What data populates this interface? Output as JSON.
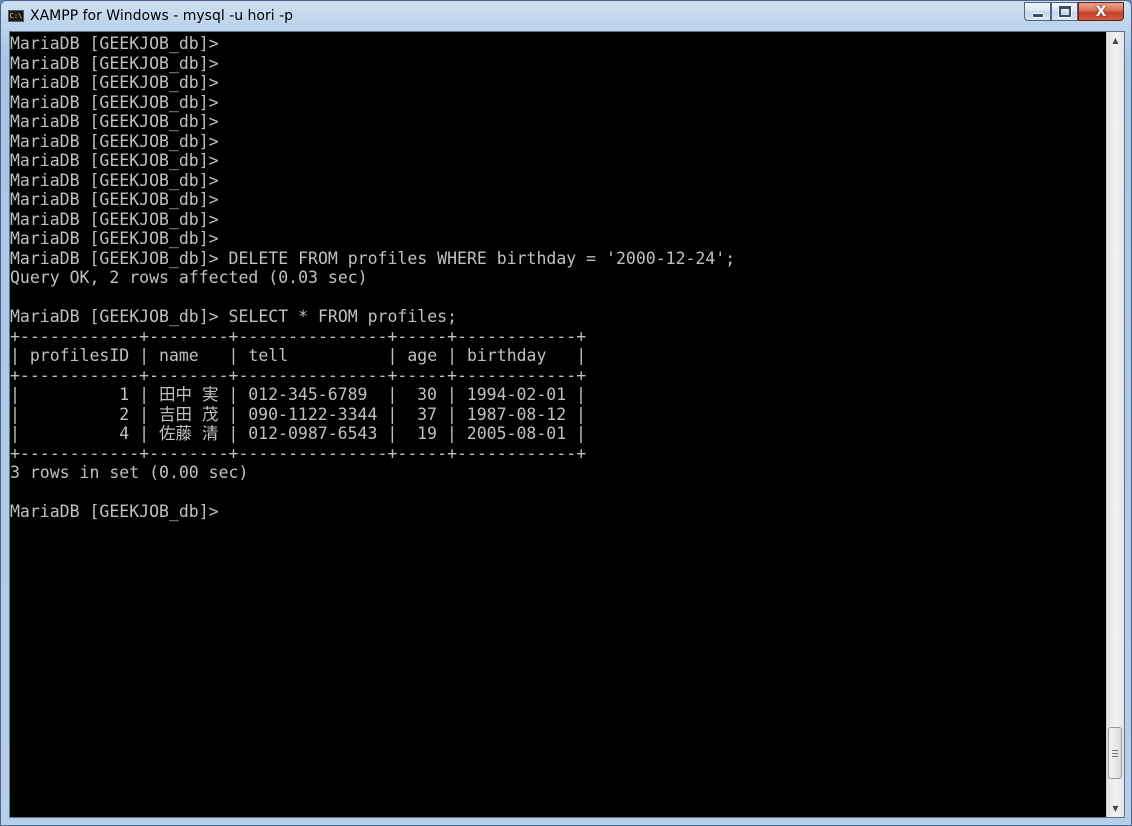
{
  "window": {
    "title": "XAMPP for Windows - mysql  -u hori -p",
    "icon": "console-icon",
    "icon_text": "C:\\",
    "buttons": {
      "minimize": "minimize-icon",
      "maximize": "maximize-icon",
      "close": "close-icon",
      "close_glyph": "X"
    }
  },
  "terminal": {
    "lines": [
      "MariaDB [GEEKJOB_db]>",
      "MariaDB [GEEKJOB_db]>",
      "MariaDB [GEEKJOB_db]>",
      "MariaDB [GEEKJOB_db]>",
      "MariaDB [GEEKJOB_db]>",
      "MariaDB [GEEKJOB_db]>",
      "MariaDB [GEEKJOB_db]>",
      "MariaDB [GEEKJOB_db]>",
      "MariaDB [GEEKJOB_db]>",
      "MariaDB [GEEKJOB_db]>",
      "MariaDB [GEEKJOB_db]>",
      "MariaDB [GEEKJOB_db]> DELETE FROM profiles WHERE birthday = '2000-12-24';",
      "Query OK, 2 rows affected (0.03 sec)",
      "",
      "MariaDB [GEEKJOB_db]> SELECT * FROM profiles;",
      "+------------+--------+---------------+-----+------------+",
      "| profilesID | name   | tell          | age | birthday   |",
      "+------------+--------+---------------+-----+------------+",
      "|          1 | 田中 実 | 012-345-6789  |  30 | 1994-02-01 |",
      "|          2 | 吉田 茂 | 090-1122-3344 |  37 | 1987-08-12 |",
      "|          4 | 佐藤 清 | 012-0987-6543 |  19 | 2005-08-01 |",
      "+------------+--------+---------------+-----+------------+",
      "3 rows in set (0.00 sec)",
      "",
      "MariaDB [GEEKJOB_db]>"
    ]
  },
  "scrollbar": {
    "up_icon": "scroll-up-arrow-icon",
    "down_icon": "scroll-down-arrow-icon",
    "position_fraction": 0.97
  },
  "colors": {
    "console_background": "#000000",
    "console_text": "#c0c0c0",
    "close_button": "#c4432b"
  }
}
